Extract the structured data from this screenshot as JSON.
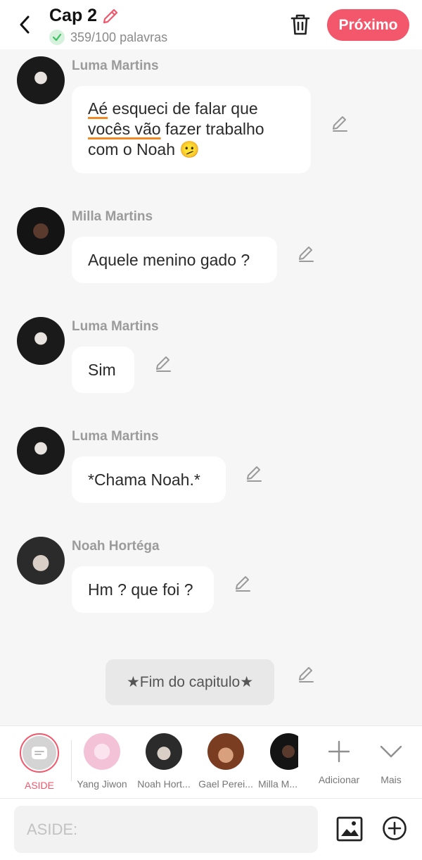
{
  "header": {
    "title": "Cap 2",
    "word_count": "359/100 palavras",
    "next_label": "Próximo"
  },
  "messages": [
    {
      "name": "Luma Martins",
      "parts": [
        "Aé",
        " esqueci de falar que ",
        "vocês vão",
        " fazer trabalho com o Noah ",
        "🫤"
      ]
    },
    {
      "name": "Milla Martins",
      "text": "Aquele menino gado ?"
    },
    {
      "name": "Luma Martins",
      "text": "Sim"
    },
    {
      "name": "Luma Martins",
      "text": "*Chama Noah.*"
    },
    {
      "name": "Noah Hortéga",
      "text": "Hm ? que foi ?"
    }
  ],
  "aside_message": "★Fim do capitulo★",
  "characters": [
    {
      "label": "ASIDE"
    },
    {
      "label": "Yang Jiwon"
    },
    {
      "label": "Noah Hort..."
    },
    {
      "label": "Gael Perei..."
    },
    {
      "label": "Milla M..."
    },
    {
      "label": "Adicionar"
    },
    {
      "label": "Mais"
    }
  ],
  "input": {
    "placeholder": "ASIDE:"
  },
  "colors": {
    "accent": "#f2576b",
    "underline": "#f08a26",
    "background": "#f6f6f6"
  }
}
